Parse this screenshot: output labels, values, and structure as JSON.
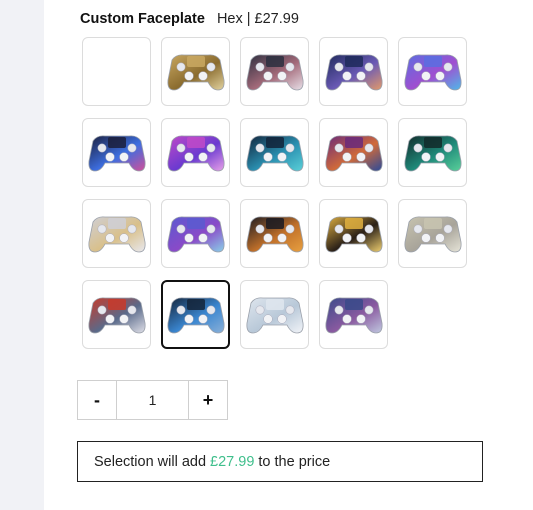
{
  "product_option": {
    "title": "Custom Faceplate",
    "selected_value": "Hex | £27.99"
  },
  "faceplates": [
    {
      "style": "none",
      "colors": []
    },
    {
      "style": "design",
      "colors": [
        "#c9a862",
        "#8a6b2e",
        "#e2d3a0"
      ]
    },
    {
      "style": "design",
      "colors": [
        "#2c2f3f",
        "#a46a7a",
        "#e8e0e8"
      ]
    },
    {
      "style": "design",
      "colors": [
        "#1f2a5c",
        "#6a5ab5",
        "#e39a6a"
      ]
    },
    {
      "style": "design",
      "colors": [
        "#5b6de0",
        "#a04fd0",
        "#4fb8e8"
      ]
    },
    {
      "style": "design",
      "colors": [
        "#1b1f3c",
        "#3d6ee0",
        "#d2509a"
      ]
    },
    {
      "style": "design",
      "colors": [
        "#c04ac8",
        "#6a3ad0",
        "#e8a0e8"
      ]
    },
    {
      "style": "design",
      "colors": [
        "#12233a",
        "#2a8fb0",
        "#5ad0d8"
      ]
    },
    {
      "style": "design",
      "colors": [
        "#6a2a7a",
        "#d06a3a",
        "#2a4a9a"
      ]
    },
    {
      "style": "design",
      "colors": [
        "#122a2a",
        "#1f8a7a",
        "#5ad09a"
      ]
    },
    {
      "style": "design",
      "colors": [
        "#cfcfd6",
        "#d9c08a",
        "#e8e8ee"
      ]
    },
    {
      "style": "design",
      "colors": [
        "#5a5ad0",
        "#8a4ac8",
        "#8ad0e8"
      ]
    },
    {
      "style": "design",
      "colors": [
        "#1a1a22",
        "#c0702a",
        "#e8a040"
      ]
    },
    {
      "style": "design",
      "colors": [
        "#e0b040",
        "#2a2018",
        "#f0d070"
      ]
    },
    {
      "style": "design",
      "colors": [
        "#c8c4b0",
        "#a8a49a",
        "#e6e4d8"
      ]
    },
    {
      "style": "design",
      "colors": [
        "#c83a2a",
        "#5a6a8a",
        "#e0e0e8"
      ]
    },
    {
      "style": "design",
      "colors": [
        "#14243a",
        "#3a86d0",
        "#8ab0d8"
      ]
    },
    {
      "style": "design",
      "colors": [
        "#dfe6ee",
        "#b8c8d8",
        "#f2f4f8"
      ]
    },
    {
      "style": "design",
      "colors": [
        "#3a4a8a",
        "#8a5aa0",
        "#c0c8e0"
      ]
    }
  ],
  "selected_faceplate_index": 16,
  "quantity": {
    "minus_label": "-",
    "value": "1",
    "plus_label": "+"
  },
  "summary": {
    "prefix": "Selection will add",
    "price": "£27.99",
    "suffix": "to the price",
    "price_color": "#3fbf8c"
  }
}
